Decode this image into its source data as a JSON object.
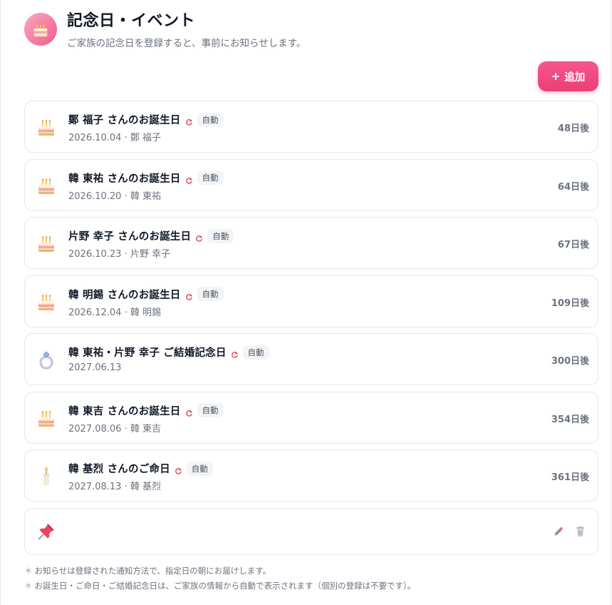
{
  "header": {
    "title": "記念日・イベント",
    "subtitle": "ご家族の記念日を登録すると、事前にお知らせします。",
    "icon": "birthday-cake-icon"
  },
  "add_button": {
    "label": "追加",
    "icon": "plus-icon"
  },
  "events": [
    {
      "icon": "birthday-cake-icon",
      "title": "鄭 福子 さんのお誕生日",
      "badge": "自動",
      "sub": "2026.10.04 · 鄭 福子",
      "days": "48日後"
    },
    {
      "icon": "birthday-cake-icon",
      "title": "韓 東祐 さんのお誕生日",
      "badge": "自動",
      "sub": "2026.10.20 · 韓 東祐",
      "days": "64日後"
    },
    {
      "icon": "birthday-cake-icon",
      "title": "片野 幸子 さんのお誕生日",
      "badge": "自動",
      "sub": "2026.10.23 · 片野 幸子",
      "days": "67日後"
    },
    {
      "icon": "birthday-cake-icon",
      "title": "韓 明錫 さんのお誕生日",
      "badge": "自動",
      "sub": "2026.12.04 · 韓 明錫",
      "days": "109日後"
    },
    {
      "icon": "ring-icon",
      "title": "韓 東祐・片野 幸子 ご結婚記念日",
      "badge": "自動",
      "sub": "2027.06.13",
      "days": "300日後"
    },
    {
      "icon": "birthday-cake-icon",
      "title": "韓 東吉 さんのお誕生日",
      "badge": "自動",
      "sub": "2027.08.06 · 韓 東吉",
      "days": "354日後"
    },
    {
      "icon": "candle-icon",
      "title": "韓 基烈 さんのご命日",
      "badge": "自動",
      "sub": "2027.08.13 · 韓 基烈",
      "days": "361日後"
    }
  ],
  "manual_entry": {
    "icon": "pushpin-icon",
    "edit_icon": "pencil-icon",
    "delete_icon": "trash-icon"
  },
  "notes": {
    "mark": "＊",
    "line1": "お知らせは登録された通知方法で、指定日の朝にお届けします。",
    "line2": "お誕生日・ご命日・ご結婚記念日は、ご家族の情報から自動で表示されます（個別の登録は不要です）。"
  },
  "colors": {
    "accent": "#ec3f75",
    "card_border": "#e5e7eb",
    "badge_bg": "#f3f4f6",
    "refresh": "#e0475b"
  }
}
